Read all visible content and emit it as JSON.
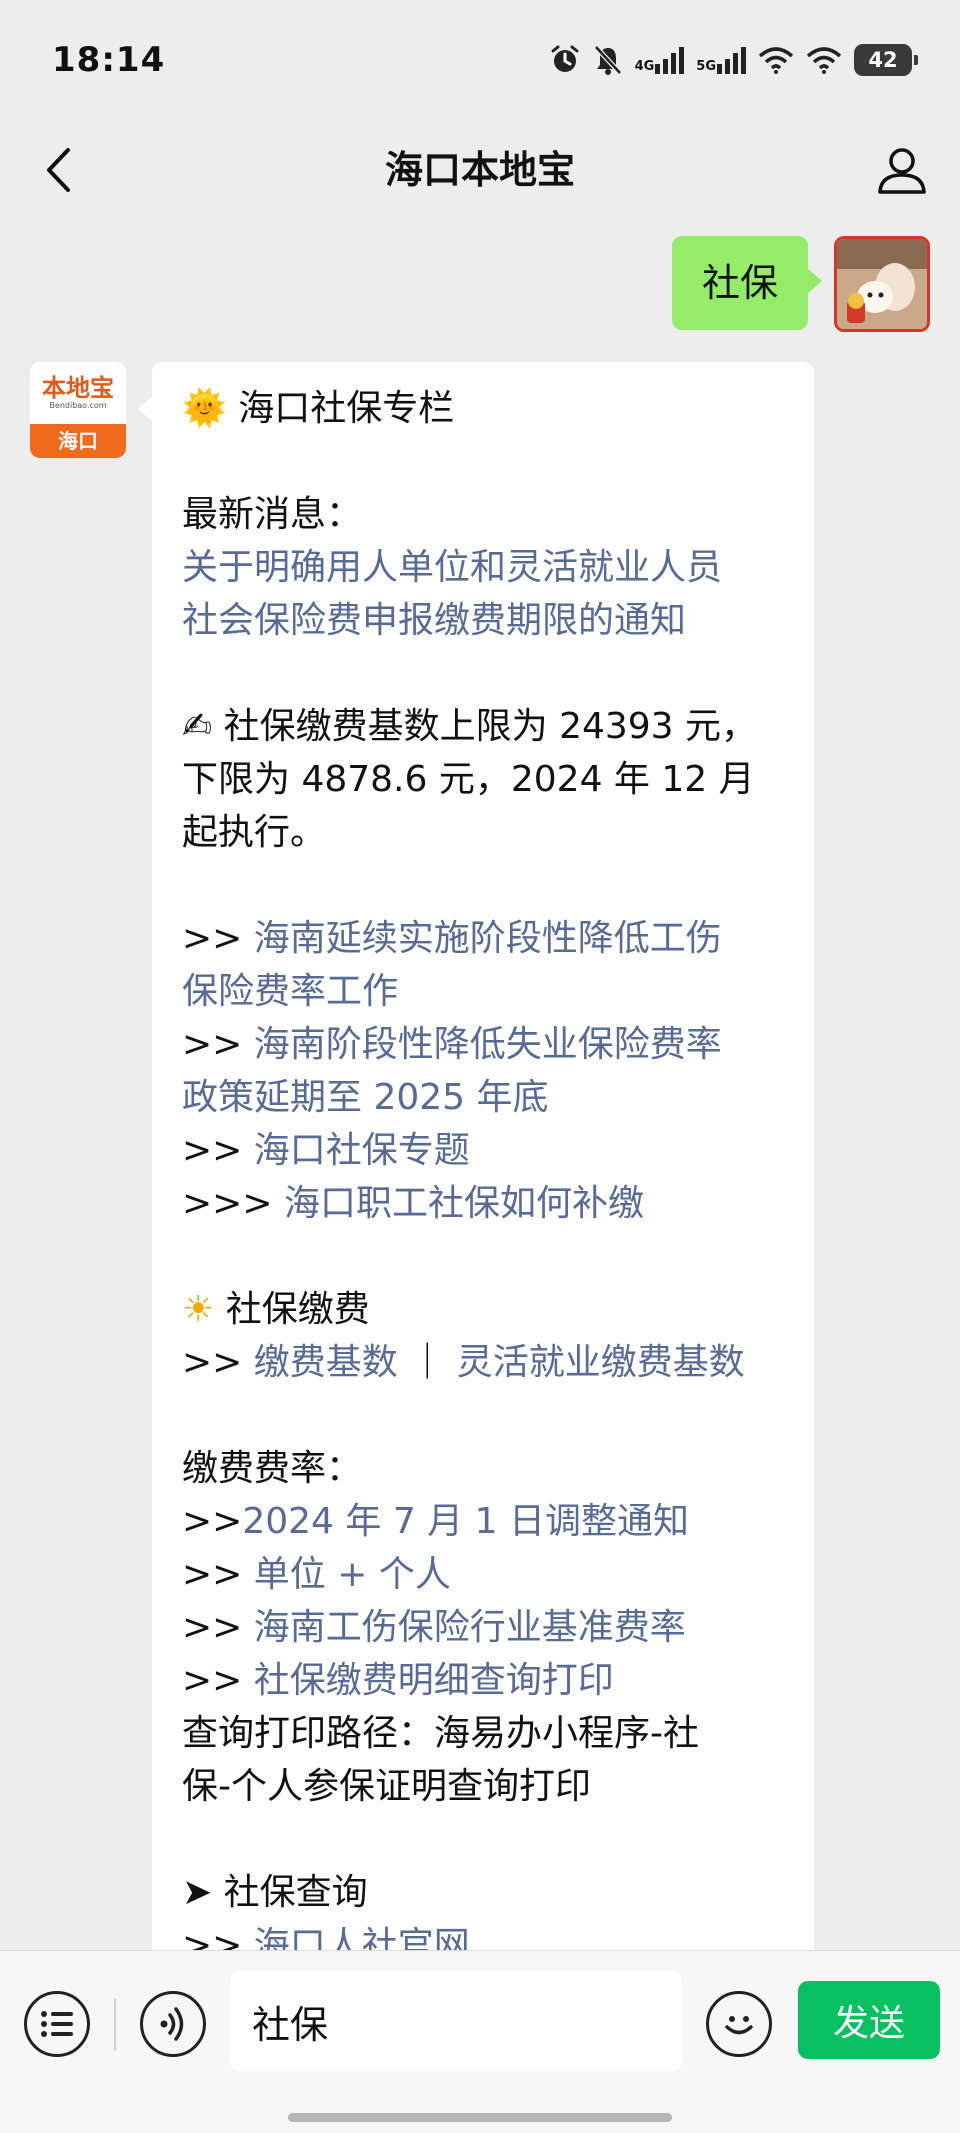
{
  "status_bar": {
    "time": "18:14",
    "network_1": "4G",
    "network_2": "5G",
    "battery": "42"
  },
  "nav": {
    "title": "海口本地宝"
  },
  "sent_message": {
    "text": "社保"
  },
  "bot_avatar": {
    "logo_text": "本地宝",
    "logo_sub": "Bendibao.com",
    "label": "海口"
  },
  "reply": {
    "header_emoji": "🌞",
    "header": "海口社保专栏",
    "latest_label": "最新消息：",
    "latest_link_1": "关于明确用人单位和灵活就业人员",
    "latest_link_2": "社会保险费申报缴费期限的通知",
    "note_emoji": "✍",
    "note_1": "社保缴费基数上限为 24393 元，",
    "note_2": "下限为 4878.6 元，2024 年 12 月",
    "note_3": "起执行。",
    "prefix_2": ">> ",
    "prefix_3": ">>> ",
    "prefix_0": ">>",
    "news_1a": "海南延续实施阶段性降低工伤",
    "news_1b": "保险费率工作",
    "news_2a": "海南阶段性降低失业保险费率",
    "news_2b": "政策延期至 2025 年底",
    "news_3": "海口社保专题",
    "news_4": "海口职工社保如何补缴",
    "pay_emoji": "☀",
    "pay_header": "社保缴费",
    "pay_link_1": "缴费基数",
    "pay_sep": " ｜ ",
    "pay_link_2": "灵活就业缴费基数",
    "rate_label": "缴费费率：",
    "rate_link_1": "2024 年 7 月 1 日调整通知",
    "rate_link_2": "单位 + 个人",
    "rate_link_3": "海南工伤保险行业基准费率",
    "rate_link_4": "社保缴费明细查询打印",
    "path_1": "查询打印路径：海易办小程序-社",
    "path_2": "保-个人参保证明查询打印",
    "query_arrow": "➤",
    "query_header": "社保查询",
    "query_link_1": "海口人社官网"
  },
  "input_bar": {
    "value": "社保",
    "send_label": "发送"
  },
  "colors": {
    "sent_bubble": "#95ec69",
    "link": "#576b95",
    "send_button": "#07c160"
  }
}
